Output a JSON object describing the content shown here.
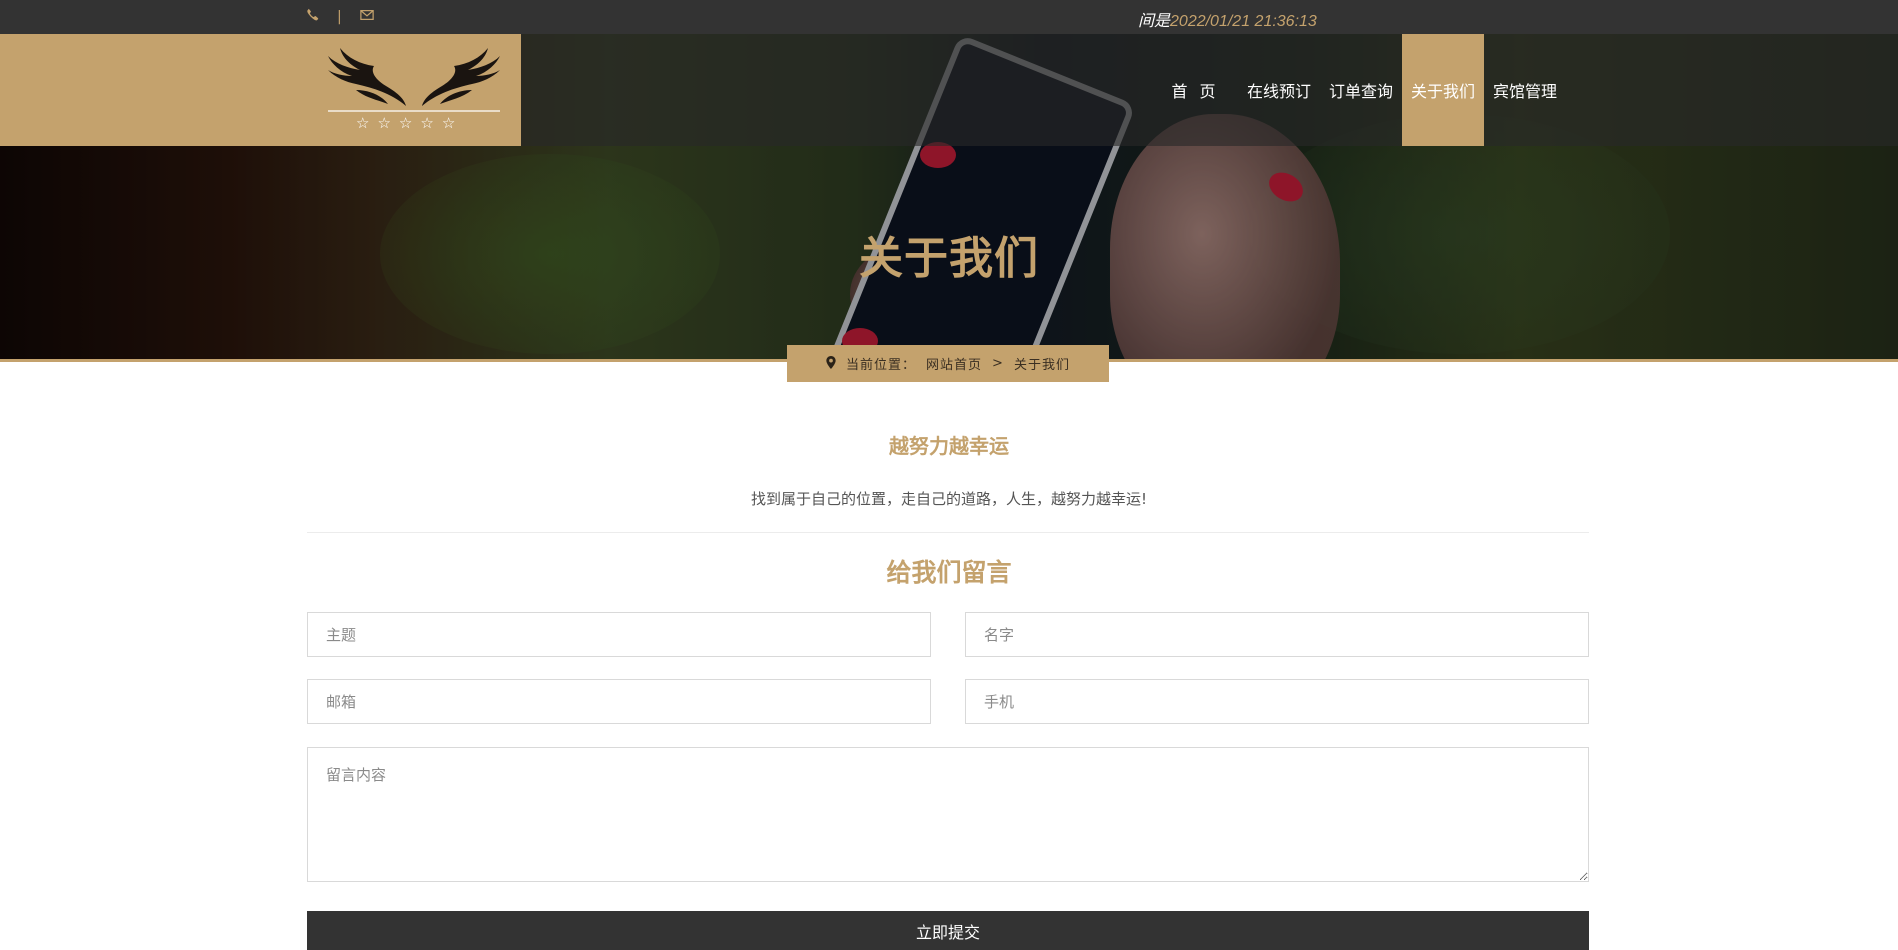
{
  "topbar": {
    "phone_icon": "phone-icon",
    "separator": "|",
    "mail_icon": "envelope-icon",
    "clock_label": "间是",
    "clock_value": "2022/01/21 21:36:13"
  },
  "logo": {
    "name": "winged-five-star-logo",
    "stars": 5
  },
  "nav": {
    "items": [
      {
        "label": "首页"
      },
      {
        "label": "在线预订"
      },
      {
        "label": "订单查询"
      },
      {
        "label": "关于我们",
        "active": true
      },
      {
        "label": "宾馆管理"
      }
    ]
  },
  "hero": {
    "title": "关于我们"
  },
  "breadcrumb": {
    "pin_icon": "map-marker-icon",
    "prefix": "当前位置：",
    "home": "网站首页",
    "separator": ">",
    "current": "关于我们"
  },
  "about": {
    "title": "越努力越幸运",
    "slogan": "找到属于自己的位置，走自己的道路，人生，越努力越幸运!"
  },
  "form": {
    "title": "给我们留言",
    "subject_placeholder": "主题",
    "name_placeholder": "名字",
    "email_placeholder": "邮箱",
    "phone_placeholder": "手机",
    "message_placeholder": "留言内容",
    "submit_label": "立即提交"
  },
  "colors": {
    "accent": "#c4a26d",
    "dark": "#333333"
  }
}
